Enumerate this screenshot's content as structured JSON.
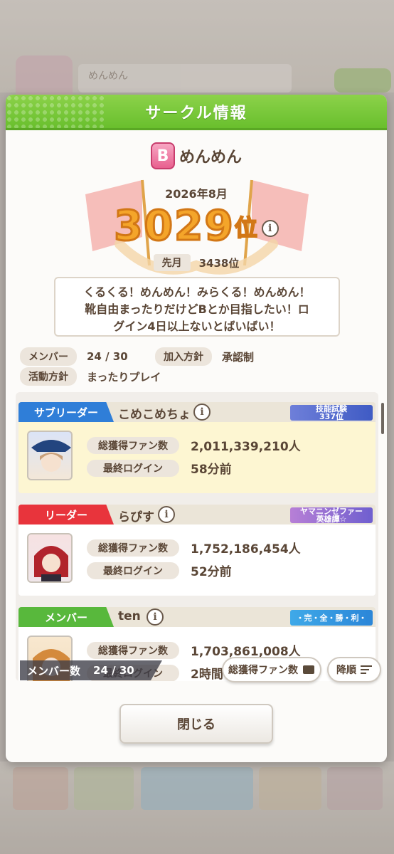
{
  "background": {
    "circle_name_hint": "めんめん"
  },
  "dialog": {
    "title": "サークル情報",
    "rank_badge_letter": "B",
    "circle_name": "めんめん",
    "month": "2026年8月",
    "rank_number": "3029",
    "rank_unit": "位",
    "info_glyph": "i",
    "prev_label": "先月",
    "prev_value": "3438位",
    "description_lines": [
      "くるくる！めんめん！みらくる！めんめん！",
      "靴自由まったりだけどBとか目指したい！ロ",
      "グイン4日以上ないとばいばい！"
    ],
    "meta": {
      "members_label": "メンバー",
      "members_value": "24 / 30",
      "join_label": "加入方針",
      "join_value": "承認制",
      "policy_label": "活動方針",
      "policy_value": "まったりプレイ"
    },
    "members": [
      {
        "role": "サブリーダー",
        "name": "こめこめちょ",
        "title_line1": "技能試験",
        "title_line2": "337位",
        "fans_label": "総獲得ファン数",
        "fans_value": "2,011,339,210人",
        "login_label": "最終ログイン",
        "login_value": "58分前"
      },
      {
        "role": "リーダー",
        "name": "らぴす",
        "title_line1": "ヤマニンゼファー",
        "title_line2": "英雄譚☆",
        "fans_label": "総獲得ファン数",
        "fans_value": "1,752,186,454人",
        "login_label": "最終ログイン",
        "login_value": "52分前"
      },
      {
        "role": "メンバー",
        "name": "ten",
        "title_line1": "・完・全・勝・利・",
        "title_line2": "",
        "fans_label": "総獲得ファン数",
        "fans_value": "1,703,861,008人",
        "login_label": "最終ログイン",
        "login_value": "2時間"
      }
    ],
    "member_count_label": "メンバー数",
    "member_count_value": "24 / 30",
    "sort_fans_label": "総獲得ファン数",
    "sort_order_label": "降順",
    "close_label": "閉じる"
  },
  "colors": {
    "header_green": "#69bf2d",
    "rank_gold": "#f4a52a",
    "sub_leader_blue": "#2f7ed8",
    "leader_red": "#e8343c",
    "member_green": "#58b83c"
  }
}
